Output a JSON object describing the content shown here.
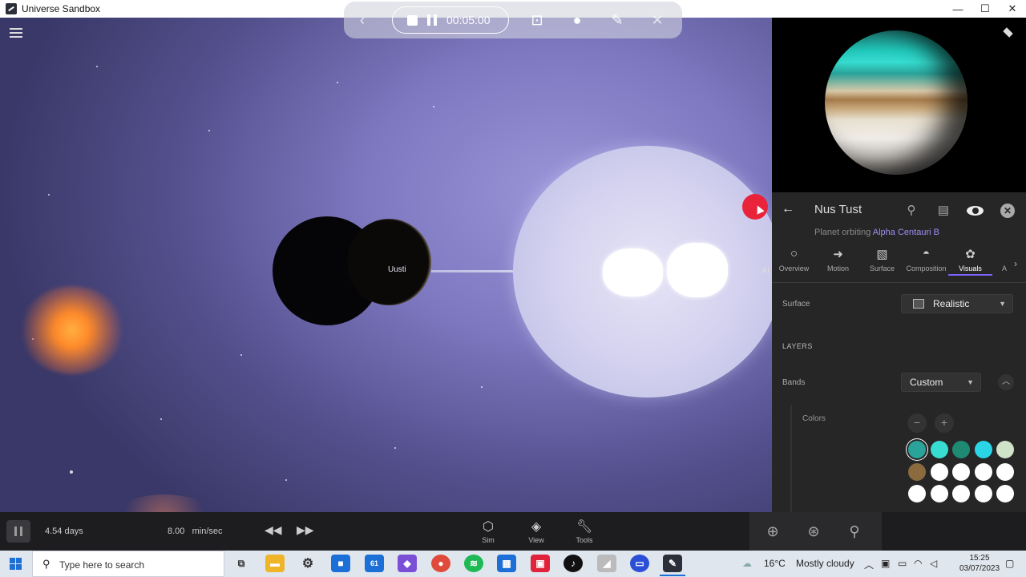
{
  "window": {
    "title": "Universe Sandbox"
  },
  "recorder": {
    "time": "00:05:00"
  },
  "viewport": {
    "planet_label": "Uusti",
    "edge_label": "Al"
  },
  "simbar": {
    "days": "4.54 days",
    "speed": "8.00",
    "speed_unit": "min/sec",
    "tools": [
      {
        "label": "Sim",
        "icon": "cube-icon"
      },
      {
        "label": "View",
        "icon": "layers-icon"
      },
      {
        "label": "Tools",
        "icon": "wrench-icon"
      }
    ]
  },
  "panel": {
    "object_name": "Nus Tust",
    "subtitle_prefix": "Planet orbiting",
    "subtitle_link": "Alpha Centauri B",
    "tabs": [
      {
        "label": "Overview",
        "icon": "circle-icon"
      },
      {
        "label": "Motion",
        "icon": "motion-icon"
      },
      {
        "label": "Surface",
        "icon": "surface-icon"
      },
      {
        "label": "Composition",
        "icon": "composition-icon"
      },
      {
        "label": "Visuals",
        "icon": "palette-icon"
      },
      {
        "label": "A",
        "icon": "partial-icon"
      }
    ],
    "active_tab": "Visuals",
    "surface_label": "Surface",
    "surface_value": "Realistic",
    "layers_heading": "LAYERS",
    "bands_label": "Bands",
    "bands_value": "Custom",
    "colors_label": "Colors",
    "swatches": [
      "#2aa39a",
      "#36ddd0",
      "#1f8a73",
      "#2ad6e6",
      "#cfe3c8",
      "#8b6a3e",
      "#ffffff",
      "#ffffff",
      "#ffffff",
      "#ffffff",
      "#ffffff",
      "#ffffff",
      "#ffffff",
      "#ffffff",
      "#ffffff"
    ]
  },
  "taskbar": {
    "search_placeholder": "Type here to search",
    "mail_badge": "61",
    "temperature": "16°C",
    "weather": "Mostly cloudy",
    "time": "15:25",
    "date": "03/07/2023"
  },
  "colors": {
    "accent": "#7b61ff",
    "link": "#a08cf0",
    "record_dot": "#e8233a"
  }
}
